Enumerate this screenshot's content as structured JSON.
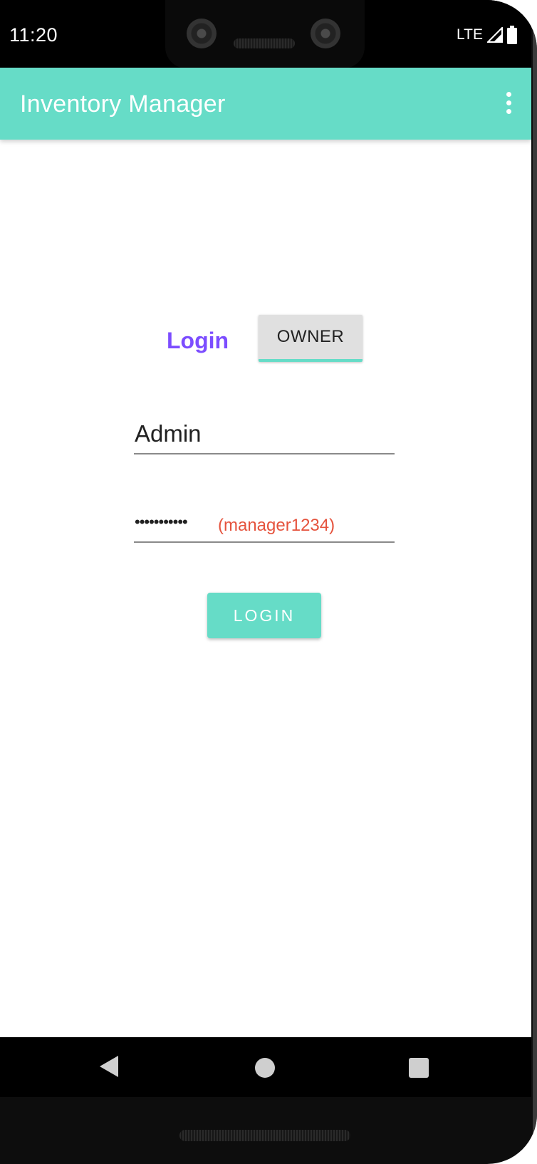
{
  "status_bar": {
    "time": "11:20",
    "network": "LTE",
    "icons": [
      "signal-icon",
      "battery-icon"
    ]
  },
  "app_bar": {
    "title": "Inventory Manager",
    "menu_icon": "overflow-menu-icon"
  },
  "login_form": {
    "heading": "Login",
    "role_button_label": "OWNER",
    "username_value": "Admin",
    "password_masked": "•••••••••••",
    "password_hint": "(manager1234)",
    "login_button_label": "LOGIN"
  },
  "nav_bar": {
    "icons": [
      "back-icon",
      "home-icon",
      "recents-icon"
    ]
  },
  "colors": {
    "accent": "#66dcc7",
    "login_label": "#7c4dff",
    "hint": "#e5533d"
  }
}
